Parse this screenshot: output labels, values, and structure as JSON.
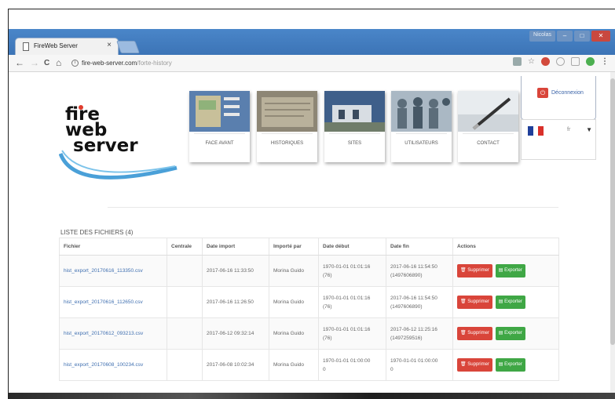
{
  "browser": {
    "tab_title": "FireWeb Server",
    "tab_close": "×",
    "user_label": "Nicolas",
    "win_min": "–",
    "win_max": "□",
    "win_close": "✕",
    "url_host": "fire-web-server.com",
    "url_path": "/forte-history",
    "back": "←",
    "forward": "→",
    "reload": "C",
    "home": "⌂",
    "menu": "⋮",
    "colors": {
      "titlebar": "#4a86c9",
      "close": "#c9483f"
    }
  },
  "site": {
    "logo": {
      "line1": "fire",
      "line2": "web",
      "line3": "server"
    },
    "menu": [
      {
        "label": "FACE AVANT",
        "icon": "control-panel-image"
      },
      {
        "label": "HISTORIQUES",
        "icon": "history-image"
      },
      {
        "label": "SITES",
        "icon": "building-image"
      },
      {
        "label": "UTILISATEURS",
        "icon": "people-image"
      },
      {
        "label": "CONTACT",
        "icon": "pen-image"
      }
    ],
    "logout_label": "Déconnexion",
    "lang_code": "fr",
    "accent_red": "#d9453a",
    "accent_green": "#3fa745",
    "link_color": "#3f6fb0"
  },
  "files": {
    "title": "LISTE DES FICHIERS (4)",
    "headers": [
      "Fichier",
      "Centrale",
      "Date import",
      "Importé par",
      "Date début",
      "Date fin",
      "Actions"
    ],
    "delete_label": "Supprimer",
    "export_label": "Exporter",
    "rows": [
      {
        "file": "hist_export_20170616_113350.csv",
        "centrale": "",
        "date_import": "2017-06-16 11:33:50",
        "imported_by": "Morina Guido",
        "start": "1970-01-01 01:01:16",
        "start_sub": "(76)",
        "end": "2017-06-16 11:54:50",
        "end_sub": "(1497606890)"
      },
      {
        "file": "hist_export_20170616_112650.csv",
        "centrale": "",
        "date_import": "2017-06-16 11:26:50",
        "imported_by": "Morina Guido",
        "start": "1970-01-01 01:01:16",
        "start_sub": "(76)",
        "end": "2017-06-16 11:54:50",
        "end_sub": "(1497606890)"
      },
      {
        "file": "hist_export_20170612_093213.csv",
        "centrale": "",
        "date_import": "2017-06-12 09:32:14",
        "imported_by": "Morina Guido",
        "start": "1970-01-01 01:01:16",
        "start_sub": "(76)",
        "end": "2017-06-12 11:25:16",
        "end_sub": "(1497259516)"
      },
      {
        "file": "hist_export_20170608_100234.csv",
        "centrale": "",
        "date_import": "2017-06-08 10:02:34",
        "imported_by": "Morina Guido",
        "start": "1970-01-01 01:00:00",
        "start_sub": "0",
        "end": "1970-01-01 01:00:00",
        "end_sub": "0"
      }
    ]
  }
}
